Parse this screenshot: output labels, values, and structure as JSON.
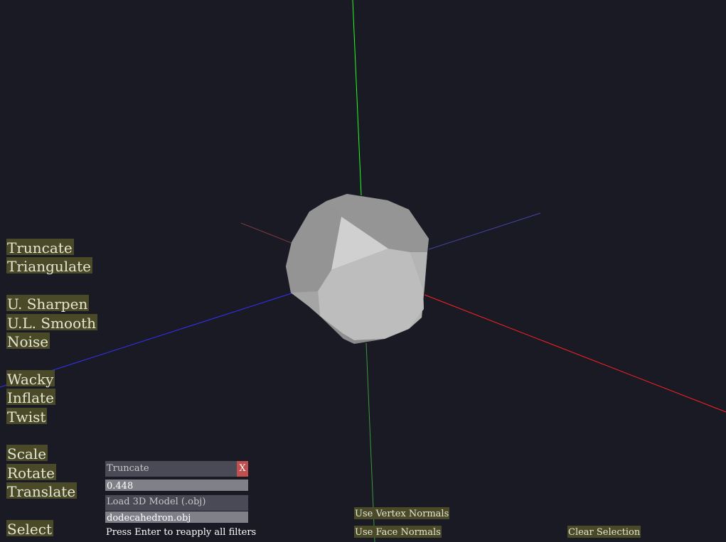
{
  "scene": {
    "model_name": "dodecahedron",
    "colors": {
      "background": "#1a1a24",
      "axis_x": "#ff2222",
      "axis_y": "#22ff22",
      "axis_z": "#3333ff",
      "mesh_light": "#bebebe",
      "mesh_dark": "#8f8f8f"
    }
  },
  "menu": {
    "truncate": "Truncate",
    "triangulate": "Triangulate",
    "u_sharpen": "U. Sharpen",
    "ul_smooth": "U.L. Smooth",
    "noise": "Noise",
    "wacky": "Wacky",
    "inflate": "Inflate",
    "twist": "Twist",
    "scale": "Scale",
    "rotate": "Rotate",
    "translate": "Translate",
    "select": "Select"
  },
  "filter_panel": {
    "title": "Truncate",
    "close_label": "X",
    "value": "0.448"
  },
  "model_panel": {
    "load_label": "Load 3D Model (.obj)",
    "filename": "dodecahedron.obj",
    "hint": "Press Enter to reapply all filters"
  },
  "toolbar": {
    "vertex_normals": "Use Vertex Normals",
    "face_normals": "Use Face Normals",
    "clear_selection": "Clear Selection"
  }
}
